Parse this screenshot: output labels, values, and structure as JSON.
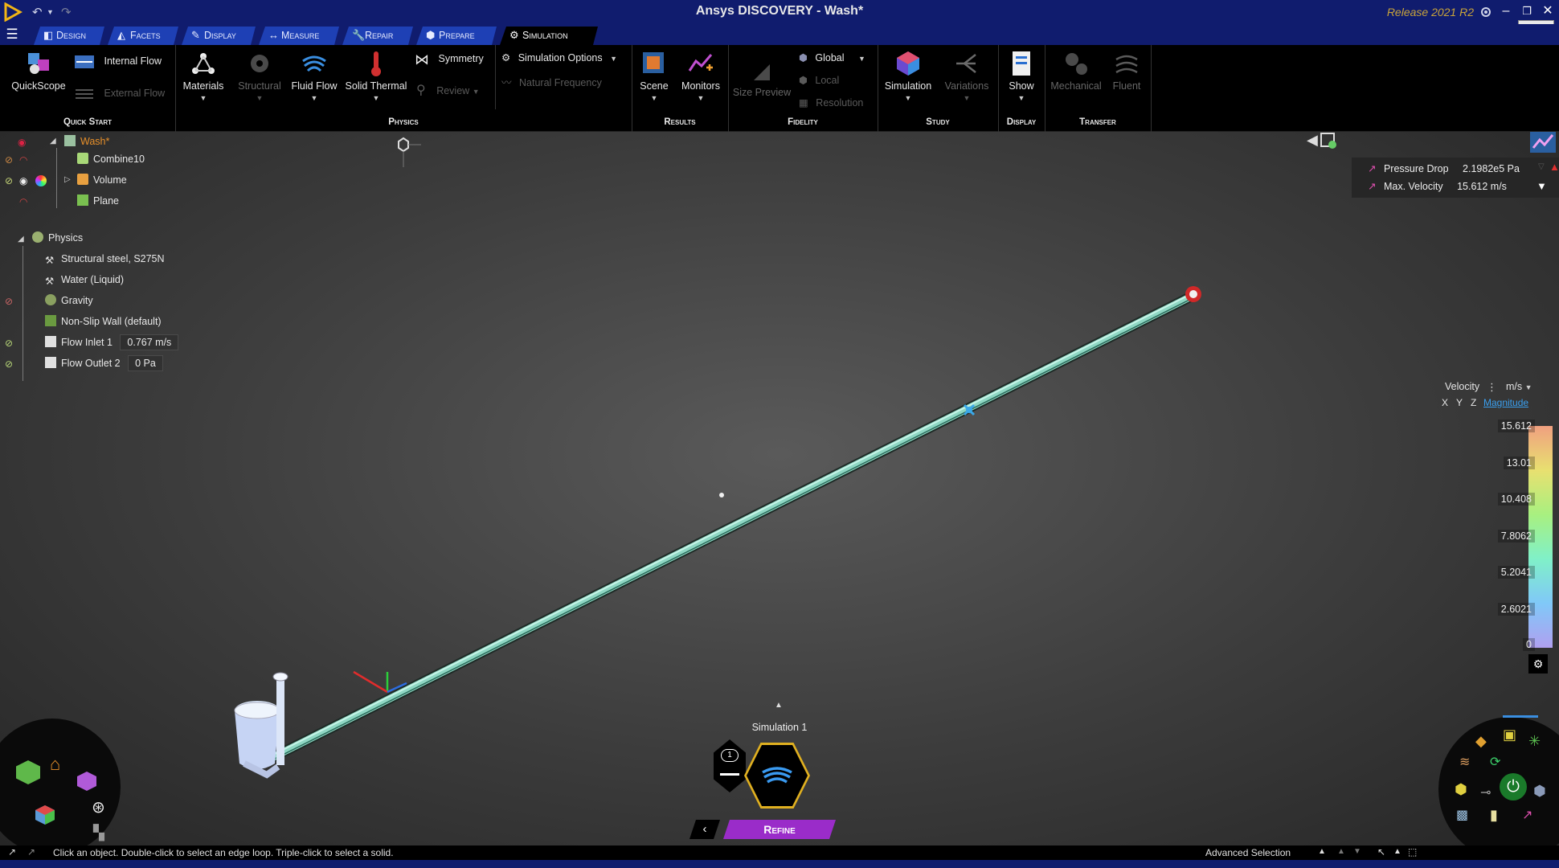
{
  "window": {
    "title": "Ansys DISCOVERY - Wash*",
    "release": "Release 2021 R2",
    "close_tooltip": "Close"
  },
  "tabs": [
    {
      "label": "Design",
      "icon": "design-icon"
    },
    {
      "label": "Facets",
      "icon": "facets-icon"
    },
    {
      "label": "Display",
      "icon": "display-icon"
    },
    {
      "label": "Measure",
      "icon": "measure-icon"
    },
    {
      "label": "Repair",
      "icon": "repair-icon"
    },
    {
      "label": "Prepare",
      "icon": "prepare-icon"
    },
    {
      "label": "Simulation",
      "icon": "simulation-icon",
      "active": true
    }
  ],
  "ribbon": {
    "quickstart": {
      "group": "Quick Start",
      "quickscope": "QuickScope",
      "internal_flow": "Internal Flow",
      "external_flow": "External Flow"
    },
    "physics": {
      "group": "Physics",
      "materials": "Materials",
      "structural": "Structural",
      "fluid_flow": "Fluid Flow",
      "solid_thermal": "Solid Thermal",
      "symmetry": "Symmetry",
      "review": "Review",
      "simulation_options": "Simulation Options",
      "natural_frequency": "Natural Frequency"
    },
    "results": {
      "group": "Results",
      "scene": "Scene",
      "monitors": "Monitors"
    },
    "fidelity": {
      "group": "Fidelity",
      "size_preview": "Size Preview",
      "global": "Global",
      "local": "Local",
      "resolution": "Resolution"
    },
    "study": {
      "group": "Study",
      "simulation": "Simulation",
      "variations": "Variations"
    },
    "display": {
      "group": "Display",
      "show": "Show"
    },
    "transfer": {
      "group": "Transfer",
      "mechanical": "Mechanical",
      "fluent": "Fluent"
    }
  },
  "tree": {
    "root": "Wash*",
    "items": [
      "Combine10",
      "Volume",
      "Plane"
    ],
    "physics": {
      "label": "Physics",
      "items": [
        {
          "label": "Structural steel, S275N"
        },
        {
          "label": "Water (Liquid)"
        },
        {
          "label": "Gravity"
        },
        {
          "label": "Non-Slip Wall (default)"
        },
        {
          "label": "Flow Inlet 1",
          "value": "0.767 m/s"
        },
        {
          "label": "Flow Outlet 2",
          "value": "0 Pa"
        }
      ]
    }
  },
  "results_panel": {
    "rows": [
      {
        "label": "Pressure Drop",
        "value": "2.1982e5 Pa"
      },
      {
        "label": "Max. Velocity",
        "value": "15.612 m/s"
      }
    ]
  },
  "legend": {
    "title": "Velocity",
    "unit": "m/s",
    "components": [
      "X",
      "Y",
      "Z",
      "Magnitude"
    ],
    "active_component": "Magnitude",
    "values": [
      "15.612",
      "13.01",
      "10.408",
      "7.8062",
      "5.2041",
      "2.6021",
      "0"
    ],
    "colors": [
      "#f0a080",
      "#e8e070",
      "#a8f080",
      "#80f0c8",
      "#80c8f8",
      "#b0a0f0"
    ]
  },
  "simulation": {
    "name": "Simulation 1",
    "badge": "1",
    "mode": "Refine"
  },
  "status": {
    "hint": "Click an object. Double-click to select an edge loop. Triple-click to select a solid.",
    "advanced_selection": "Advanced Selection"
  },
  "colors": {
    "title_bar": "#101c6e",
    "tab": "#1e40b5",
    "refine": "#9a2cc9",
    "accent_orange": "#e8902a"
  }
}
